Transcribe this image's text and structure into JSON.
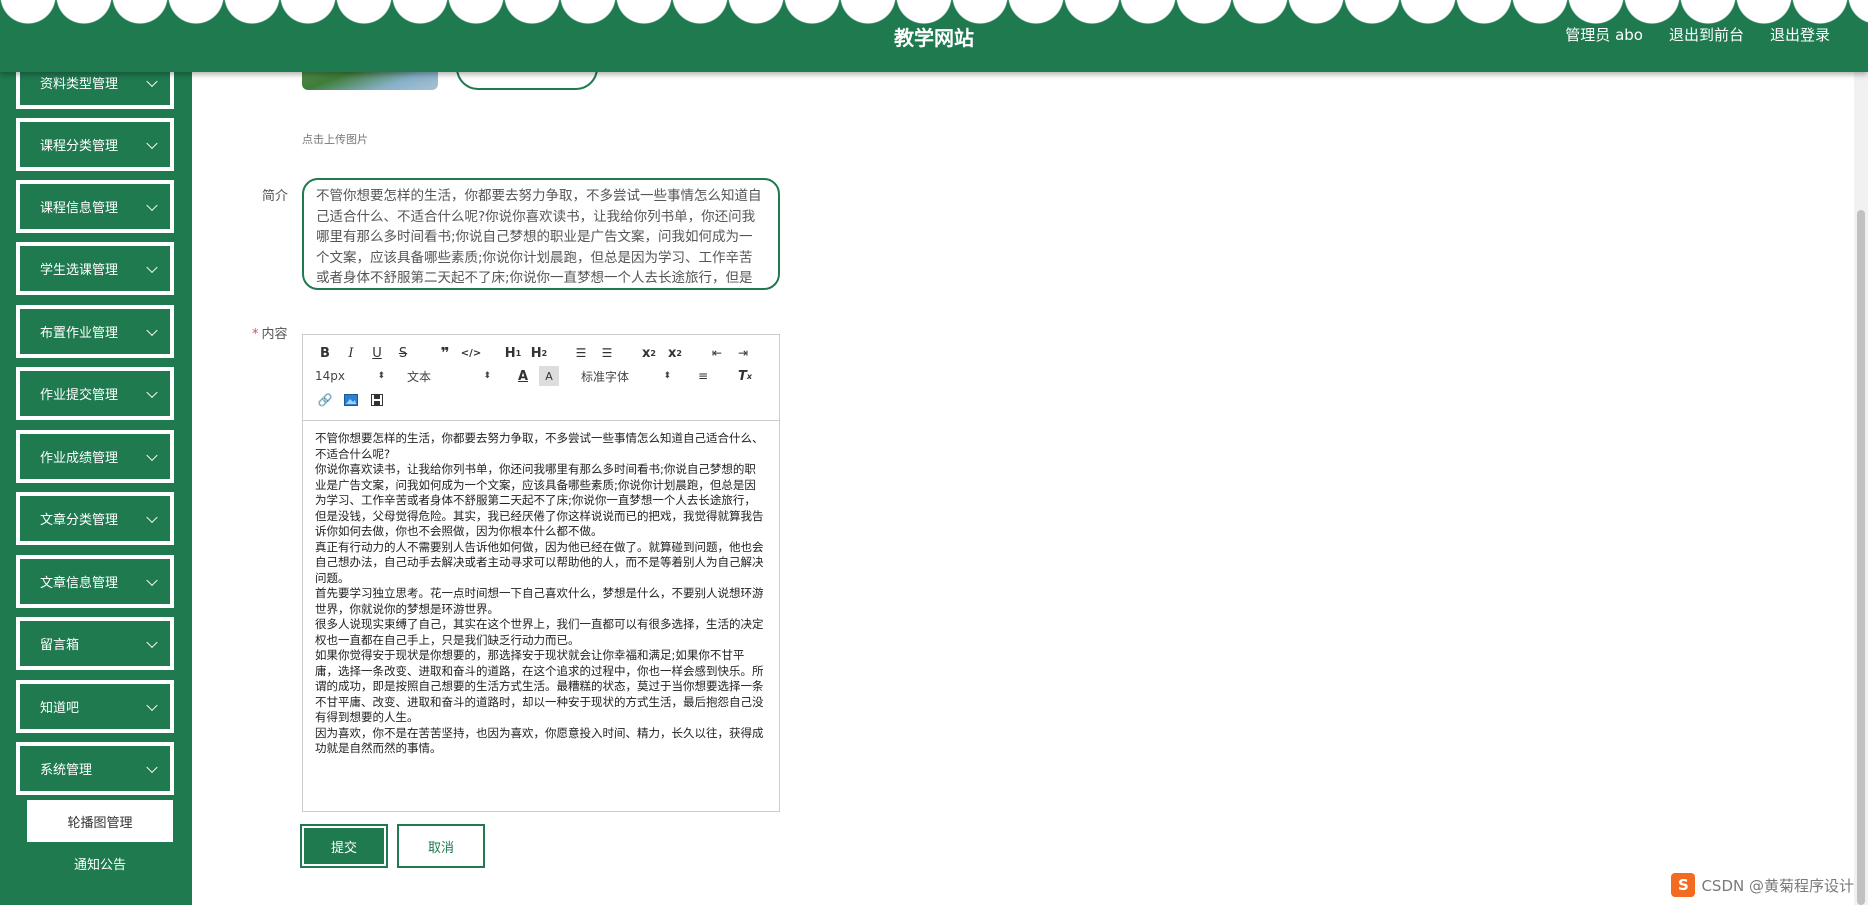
{
  "header": {
    "title": "教学网站",
    "user": "管理员 abo",
    "back_front": "退出到前台",
    "logout": "退出登录"
  },
  "sidebar": {
    "items": [
      {
        "label": "资料类型管理"
      },
      {
        "label": "课程分类管理"
      },
      {
        "label": "课程信息管理"
      },
      {
        "label": "学生选课管理"
      },
      {
        "label": "布置作业管理"
      },
      {
        "label": "作业提交管理"
      },
      {
        "label": "作业成绩管理"
      },
      {
        "label": "文章分类管理"
      },
      {
        "label": "文章信息管理"
      },
      {
        "label": "留言箱"
      },
      {
        "label": "知道吧"
      },
      {
        "label": "系统管理"
      }
    ],
    "sub_items": [
      {
        "label": "轮播图管理"
      },
      {
        "label": "通知公告"
      }
    ]
  },
  "form": {
    "upload_hint": "点击上传图片",
    "intro_label": "简介",
    "intro_value": "不管你想要怎样的生活，你都要去努力争取，不多尝试一些事情怎么知道自己适合什么、不适合什么呢?你说你喜欢读书，让我给你列书单，你还问我哪里有那么多时间看书;你说自己梦想的职业是广告文案，问我如何成为一个文案，应该具备哪些素质;你说你计划晨跑，但总是因为学习、工作辛苦或者身体不舒服第二天起不了床;你说你一直梦想一个人去长途旅行，但是没钱，父母觉得危险。",
    "content_label": "内容",
    "required_mark": "*",
    "toolbar": {
      "font_size": "14px",
      "format": "文本",
      "font_family": "标准字体"
    },
    "content_paragraphs": [
      "不管你想要怎样的生活，你都要去努力争取，不多尝试一些事情怎么知道自己适合什么、不适合什么呢?",
      "你说你喜欢读书，让我给你列书单，你还问我哪里有那么多时间看书;你说自己梦想的职业是广告文案，问我如何成为一个文案，应该具备哪些素质;你说你计划晨跑，但总是因为学习、工作辛苦或者身体不舒服第二天起不了床;你说你一直梦想一个人去长途旅行，但是没钱，父母觉得危险。其实，我已经厌倦了你这样说说而已的把戏，我觉得就算我告诉你如何去做，你也不会照做，因为你根本什么都不做。",
      "真正有行动力的人不需要别人告诉他如何做，因为他已经在做了。就算碰到问题，他也会自己想办法，自己动手去解决或者主动寻求可以帮助他的人，而不是等着别人为自己解决问题。",
      "首先要学习独立思考。花一点时间想一下自己喜欢什么，梦想是什么，不要别人说想环游世界，你就说你的梦想是环游世界。",
      "很多人说现实束缚了自己，其实在这个世界上，我们一直都可以有很多选择，生活的决定权也一直都在自己手上，只是我们缺乏行动力而已。",
      "如果你觉得安于现状是你想要的，那选择安于现状就会让你幸福和满足;如果你不甘平庸，选择一条改变、进取和奋斗的道路，在这个追求的过程中，你也一样会感到快乐。所谓的成功，即是按照自己想要的生活方式生活。最糟糕的状态，莫过于当你想要选择一条不甘平庸、改变、进取和奋斗的道路时，却以一种安于现状的方式生活，最后抱怨自己没有得到想要的人生。",
      "因为喜欢，你不是在苦苦坚持，也因为喜欢，你愿意投入时间、精力，长久以往，获得成功就是自然而然的事情。"
    ],
    "submit": "提交",
    "cancel": "取消"
  },
  "watermark": {
    "logo": "S",
    "text": "CSDN @黄菊程序设计"
  },
  "colors": {
    "brand_green": "#1f7a50",
    "required_red": "#e24a4a"
  }
}
